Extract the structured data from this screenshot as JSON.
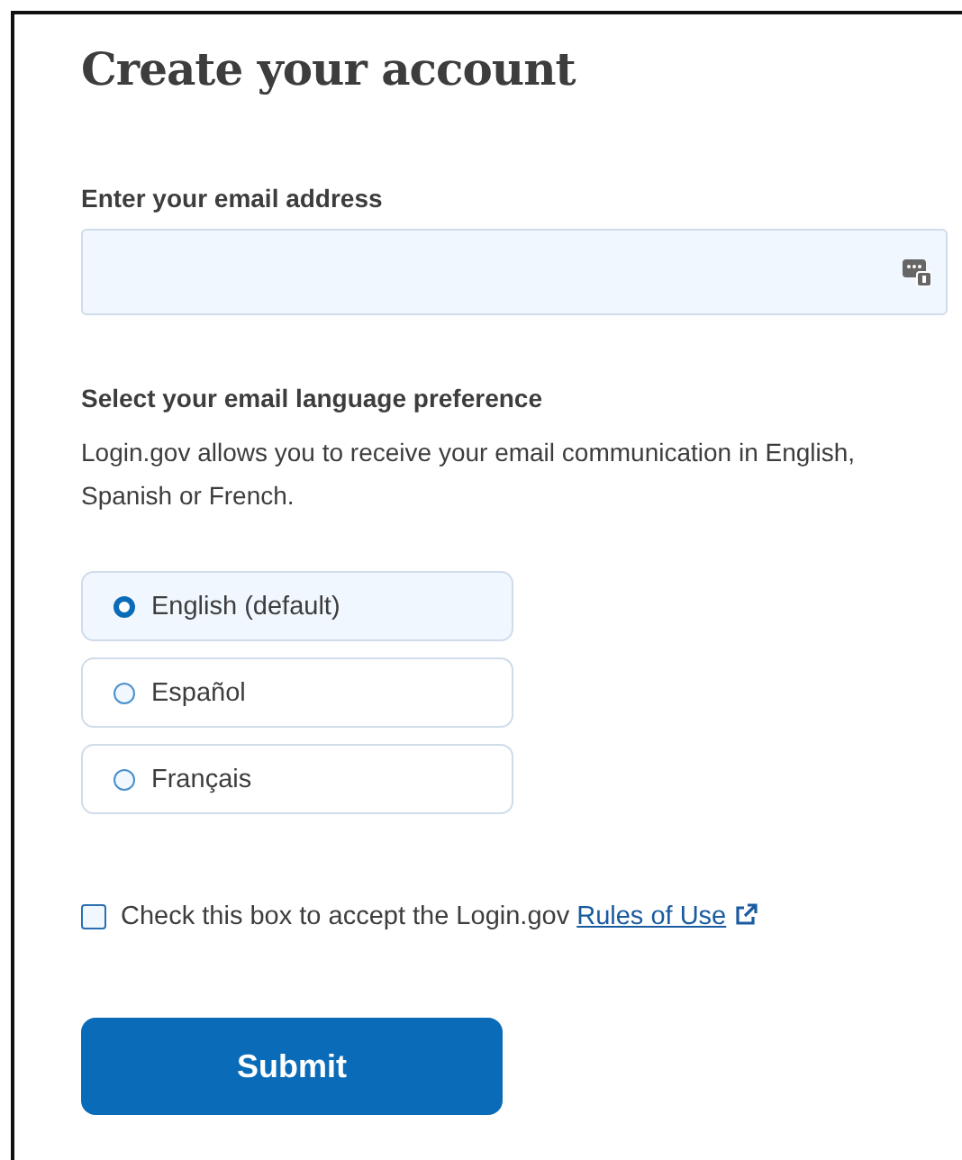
{
  "title": "Create your account",
  "email": {
    "label": "Enter your email address"
  },
  "language": {
    "legend": "Select your email language preference",
    "hint": "Login.gov allows you to receive your email communication in English, Spanish or French.",
    "options": [
      {
        "label": "English (default)",
        "selected": true
      },
      {
        "label": "Español",
        "selected": false
      },
      {
        "label": "Français",
        "selected": false
      }
    ]
  },
  "terms": {
    "text": "Check this box to accept the Login.gov ",
    "link": "Rules of Use",
    "checked": false
  },
  "submit": "Submit"
}
